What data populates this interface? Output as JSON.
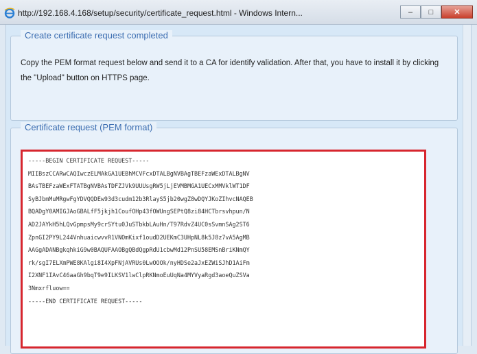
{
  "window": {
    "title": "http://192.168.4.168/setup/security/certificate_request.html - Windows Intern...",
    "minimize_glyph": "–",
    "maximize_glyph": "□",
    "close_glyph": "✕"
  },
  "completed_section": {
    "legend": "Create certificate request completed",
    "description": "Copy the PEM format request below and send it to a CA for identify validation. After that, you have to install it by clicking the \"Upload\" button on HTTPS page."
  },
  "pem_section": {
    "legend": "Certificate request (PEM format)",
    "lines": [
      "-----BEGIN CERTIFICATE REQUEST-----",
      "MIIBszCCARwCAQIwczELMAkGA1UEBhMCVFcxDTALBgNVBAgTBEFzaWExDTALBgNV",
      "BAsTBEFzaWExFTATBgNVBAsTDFZJVk9UUUsgRW5jLjEVMBMGA1UECxMMVklWT1DF",
      "SyBJbmMuMRgwFgYDVQQDEw93d3cudm12b3RlayS5jb20wgZ8wDQYJKoZIhvcNAQEB",
      "BQADgY0AMIGJAoGBALfF5jkjh1CoufOHp43fOWUngSEPtQ8zi84HCTbrsvhpun/N",
      "AD2JAYkH5hLQvGpmpsMy9crSYtu0JuSTbkbLAuHn/T97RdvZ4UC0sSvmnSAg2ST6",
      "ZpnGI2PY9L244VnhuaicwvvR1VNOmKixf1oudD2UEKmC3UHpNL8k5J8z7vA5AgMB",
      "AAGgADANBgkqhkiG9w0BAQUFAAOBgQBdQgpRdU1cbwMd12PnSU58EMSnBriKNmQY",
      "rk/sgI7ELXmPWE8KAlgi8I4XpFNjAVRUs0LwOOOk/nyHDSe2aJxEZWiSJhD1AiFm",
      "I2XNF1IAvC46aaGh9bqT9e9ILKSV1lwClpRKNmoEuUqNa4MYVyaRgd3aoeQuZSVa",
      "3Nmxrfluow==",
      "-----END CERTIFICATE REQUEST-----"
    ]
  },
  "colors": {
    "legend_text": "#3a6cb0",
    "highlight_border": "#d7262e",
    "panel_background": "#e8f1fa"
  }
}
